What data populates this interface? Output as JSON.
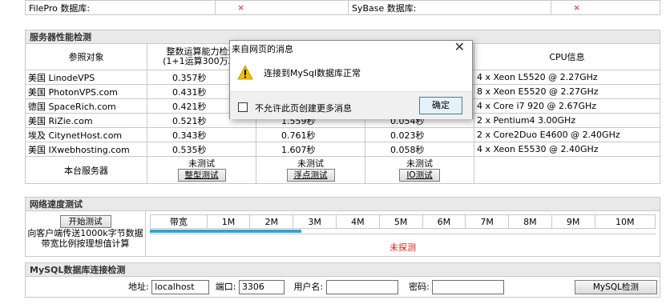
{
  "db_row": {
    "filepro_label": "FilePro 数据库:",
    "filepro_value": "×",
    "sybase_label": "SyBase 数据库:",
    "sybase_value": "×"
  },
  "perf": {
    "title": "服务器性能检测",
    "col_ref": "参照对象",
    "col_int": "整数运算能力检测",
    "col_int_sub": "(1+1运算300万次)",
    "col_cpu": "CPU信息",
    "rows": [
      {
        "name": "美国 LinodeVPS",
        "int": "0.357秒",
        "float": "",
        "io": "",
        "cpu": "4 x Xeon L5520 @ 2.27GHz"
      },
      {
        "name": "美国 PhotonVPS.com",
        "int": "0.431秒",
        "float": "",
        "io": "",
        "cpu": "8 x Xeon E5520 @ 2.27GHz"
      },
      {
        "name": "德国 SpaceRich.com",
        "int": "0.421秒",
        "float": "",
        "io": "",
        "cpu": "4 x Core i7 920 @ 2.67GHz"
      },
      {
        "name": "美国 RiZie.com",
        "int": "0.521秒",
        "float": "1.559秒",
        "io": "0.054秒",
        "cpu": "2 x Pentium4 3.00GHz"
      },
      {
        "name": "埃及 CitynetHost.com",
        "int": "0.343秒",
        "float": "0.761秒",
        "io": "0.023秒",
        "cpu": "2 x Core2Duo E4600 @ 2.40GHz"
      },
      {
        "name": "美国 IXwebhosting.com",
        "int": "0.535秒",
        "float": "1.607秒",
        "io": "0.058秒",
        "cpu": "4 x Xeon E5530 @ 2.40GHz"
      }
    ],
    "local_label": "本台服务器",
    "untested": "未测试",
    "btn_int": "整型测试",
    "btn_float": "浮点测试",
    "btn_io": "IO测试"
  },
  "net": {
    "title": "网络速度测试",
    "start_btn": "开始测试",
    "desc1": "向客户端传送1000k字节数据",
    "desc2": "带宽比例按理想值计算",
    "bw_label": "带宽",
    "scale": [
      "1M",
      "2M",
      "3M",
      "4M",
      "5M",
      "6M",
      "7M",
      "8M",
      "9M",
      "10M"
    ],
    "status": "未探测",
    "progress_fraction": 0.3
  },
  "mysql": {
    "title": "MySQL数据库连接检测",
    "addr_label": "地址:",
    "addr_value": "localhost",
    "port_label": "端口:",
    "port_value": "3306",
    "user_label": "用户名:",
    "user_value": "",
    "pwd_label": "密码:",
    "pwd_value": "",
    "btn": "MySQL检测"
  },
  "dialog": {
    "title": "来自网页的消息",
    "close": "✕",
    "message": "连接到MySql数据库正常",
    "checkbox_label": "不允许此页创建更多消息",
    "ok": "确定",
    "warn_color": "#f0c000"
  }
}
